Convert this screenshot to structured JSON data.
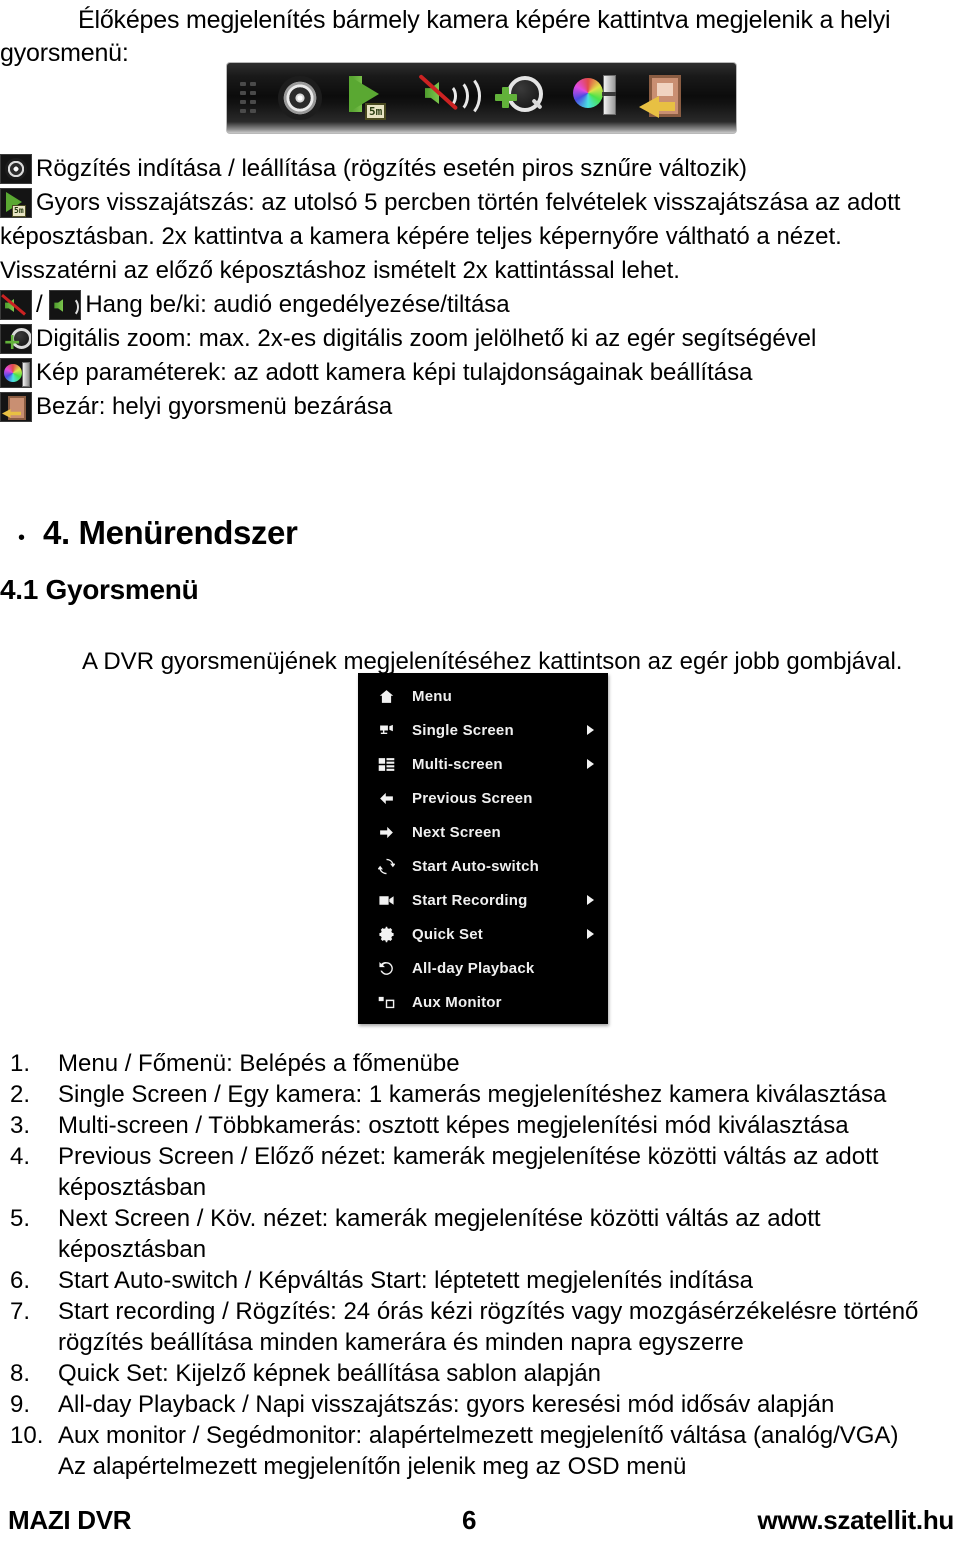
{
  "intro": {
    "line1": "Élőképes megjelenítés bármely kamera képére kattintva megjelenik a helyi",
    "line2": "gyorsmenü:"
  },
  "toolbar": {
    "name": "quick-menu-toolbar",
    "icons": [
      {
        "id": "record-icon",
        "label": "Rögzítés indítása / leállítása"
      },
      {
        "id": "quick-playback-icon",
        "label": "Gyors visszajátszás"
      },
      {
        "id": "audio-mute-icon",
        "label": "Hang be/ki"
      },
      {
        "id": "digital-zoom-icon",
        "label": "Digitális zoom"
      },
      {
        "id": "image-settings-icon",
        "label": "Kép paraméterek"
      },
      {
        "id": "close-icon",
        "label": "Bezár"
      }
    ]
  },
  "legend": {
    "record": "Rögzítés indítása / leállítása (rögzítés esetén piros sznűre változik)",
    "playback_1": "Gyors visszajátszás: az utolsó 5 percben történ felvételek visszajátszása az adott",
    "playback_2": "képosztásban. 2x kattintva a kamera képére teljes képernyőre váltható a nézet.",
    "playback_3": "Visszatérni az előző képosztáshoz ismételt 2x kattintással lehet.",
    "audio_sep": "/",
    "audio": "Hang be/ki: audió engedélyezése/tiltása",
    "zoom": "Digitális zoom: max. 2x-es digitális zoom jelölhető ki az egér segítségével",
    "image": "Kép paraméterek: az adott kamera képi tulajdonságainak beállítása",
    "close": "Bezár: helyi gyorsmenü bezárása"
  },
  "headings": {
    "bullet": "•",
    "h1": "4. Menürendszer",
    "h2": "4.1 Gyorsmenü",
    "intro_para": "A DVR gyorsmenüjének megjelenítéséhez kattintson az egér jobb gombjával."
  },
  "context_menu": {
    "items": [
      {
        "icon": "home-icon",
        "label": "Menu",
        "submenu": false
      },
      {
        "icon": "camera-icon",
        "label": "Single Screen",
        "submenu": true
      },
      {
        "icon": "multiscreen-icon",
        "label": "Multi-screen",
        "submenu": true
      },
      {
        "icon": "arrow-left-icon",
        "label": "Previous Screen",
        "submenu": false
      },
      {
        "icon": "arrow-right-icon",
        "label": "Next Screen",
        "submenu": false
      },
      {
        "icon": "loop-icon",
        "label": "Start Auto-switch",
        "submenu": false
      },
      {
        "icon": "video-camera-icon",
        "label": "Start Recording",
        "submenu": true
      },
      {
        "icon": "gear-icon",
        "label": "Quick Set",
        "submenu": true
      },
      {
        "icon": "rewind-clock-icon",
        "label": "All-day Playback",
        "submenu": false
      },
      {
        "icon": "aux-monitor-icon",
        "label": "Aux Monitor",
        "submenu": false
      }
    ],
    "background": "#000000",
    "text_color": "#f0f0f0"
  },
  "numbered_list": [
    {
      "num": "1.",
      "lines": [
        "Menu / Főmenü: Belépés a főmenübe"
      ]
    },
    {
      "num": "2.",
      "lines": [
        "Single Screen / Egy kamera: 1 kamerás megjelenítéshez kamera kiválasztása"
      ]
    },
    {
      "num": "3.",
      "lines": [
        "Multi-screen / Többkamerás: osztott képes megjelenítési mód kiválasztása"
      ]
    },
    {
      "num": "4.",
      "lines": [
        "Previous Screen / Előző nézet: kamerák megjelenítése közötti váltás az adott",
        "képosztásban"
      ]
    },
    {
      "num": "5.",
      "lines": [
        "Next Screen / Köv. nézet: kamerák megjelenítése közötti váltás az adott",
        "képosztásban"
      ]
    },
    {
      "num": "6.",
      "lines": [
        "Start Auto-switch / Képváltás Start: léptetett megjelenítés indítása"
      ]
    },
    {
      "num": "7.",
      "lines": [
        "Start recording / Rögzítés: 24 órás kézi rögzítés vagy mozgásérzékelésre történő",
        "rögzítés beállítása minden kamerára és minden napra egyszerre"
      ]
    },
    {
      "num": "8.",
      "lines": [
        "Quick Set: Kijelző képnek beállítása sablon alapján"
      ]
    },
    {
      "num": "9.",
      "lines": [
        "All-day Playback / Napi visszajátszás: gyors keresési mód idősáv alapján"
      ]
    },
    {
      "num": "10.",
      "lines": [
        "Aux monitor / Segédmonitor: alapértelmezett megjelenítő váltása (analóg/VGA)",
        "Az alapértelmezett megjelenítőn jelenik meg az OSD menü"
      ]
    }
  ],
  "footer": {
    "left": "MAZI DVR",
    "page": "6",
    "right": "www.szatellit.hu"
  }
}
